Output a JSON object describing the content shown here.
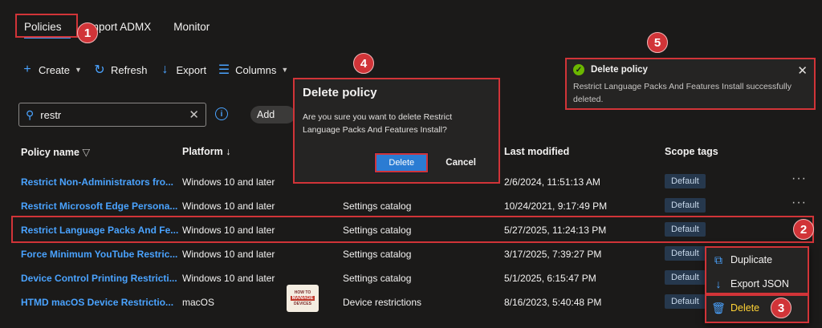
{
  "tabs": [
    {
      "label": "Policies"
    },
    {
      "label": "Import ADMX"
    },
    {
      "label": "Monitor"
    }
  ],
  "toolbar": {
    "create": "Create",
    "refresh": "Refresh",
    "export": "Export",
    "columns": "Columns"
  },
  "search": {
    "value": "restr"
  },
  "add_filter": "Add",
  "columns": {
    "policy_name": "Policy name",
    "platform": "Platform",
    "last_modified": "Last modified",
    "scope_tags": "Scope tags"
  },
  "rows": [
    {
      "name": "Restrict Non-Administrators fro...",
      "platform": "Windows 10 and later",
      "type": "",
      "modified": "2/6/2024, 11:51:13 AM",
      "tag": "Default"
    },
    {
      "name": "Restrict Microsoft Edge Persona...",
      "platform": "Windows 10 and later",
      "type": "Settings catalog",
      "modified": "10/24/2021, 9:17:49 PM",
      "tag": "Default"
    },
    {
      "name": "Restrict Language Packs And Fe...",
      "platform": "Windows 10 and later",
      "type": "Settings catalog",
      "modified": "5/27/2025, 11:24:13 PM",
      "tag": "Default"
    },
    {
      "name": "Force Minimum YouTube Restric...",
      "platform": "Windows 10 and later",
      "type": "Settings catalog",
      "modified": "3/17/2025, 7:39:27 PM",
      "tag": "Default"
    },
    {
      "name": "Device Control Printing Restricti...",
      "platform": "Windows 10 and later",
      "type": "Settings catalog",
      "modified": "5/1/2025, 6:15:47 PM",
      "tag": "Default"
    },
    {
      "name": "HTMD macOS Device Restrictio...",
      "platform": "macOS",
      "type": "Device restrictions",
      "modified": "8/16/2023, 5:40:48 PM",
      "tag": "Default"
    }
  ],
  "dialog": {
    "title": "Delete policy",
    "message": "Are you sure you want to delete Restrict Language Packs And Features Install?",
    "confirm": "Delete",
    "cancel": "Cancel"
  },
  "toast": {
    "title": "Delete policy",
    "message": "Restrict Language Packs And Features Install successfully deleted."
  },
  "context_menu": {
    "duplicate": "Duplicate",
    "export_json": "Export JSON",
    "delete": "Delete"
  },
  "steps": [
    "1",
    "2",
    "3",
    "4",
    "5"
  ],
  "logo": {
    "top": "HOW TO",
    "mid": "MANAGE",
    "bot": "DEVICES"
  },
  "colors": {
    "accent": "#4aa3ff",
    "annotation": "#d13438",
    "success": "#6bb700",
    "background": "#1b1a19"
  }
}
